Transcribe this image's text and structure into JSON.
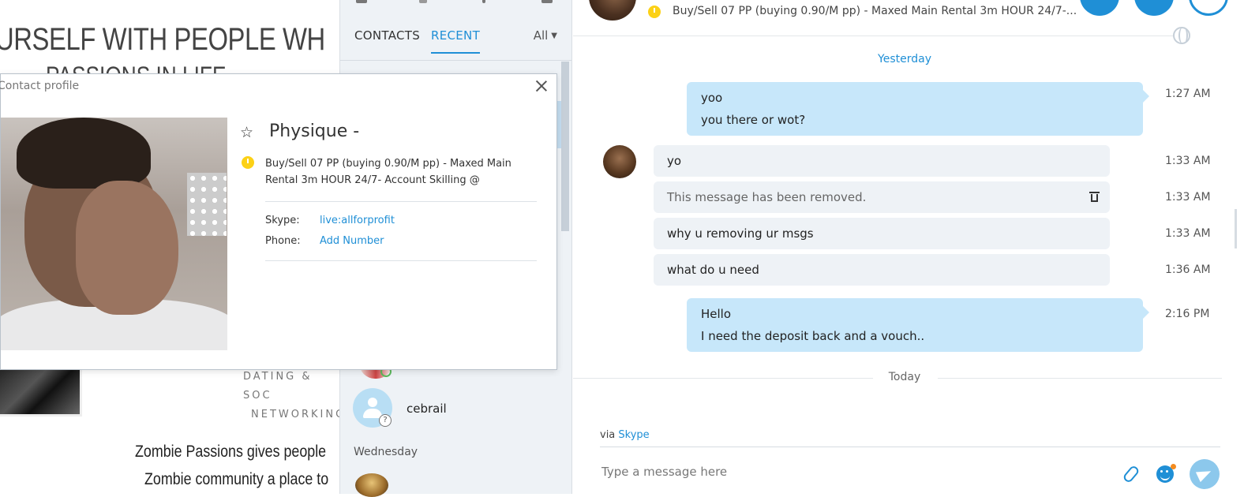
{
  "background_page": {
    "headline_line1": "URSELF WITH PEOPLE WH",
    "headline_line2": "PASSIONS IN LIFE",
    "dating_line1": "DATING & SOC",
    "dating_line2": "NETWORKING",
    "para_line1": "Zombie Passions gives people",
    "para_line2": "Zombie community a place to"
  },
  "contacts_panel": {
    "tabs": [
      "CONTACTS",
      "RECENT"
    ],
    "active_tab": "RECENT",
    "filter_label": "All",
    "contact_name": "cebrail",
    "day_label": "Wednesday"
  },
  "chat": {
    "status_text": "Buy/Sell 07 PP (buying 0.90/M pp) - Maxed Main Rental 3m HOUR 24/7-...",
    "date_yesterday": "Yesterday",
    "date_today": "Today",
    "messages": [
      {
        "direction": "out",
        "lines": [
          "yoo",
          "you there or wot?"
        ],
        "time": "1:27 AM"
      },
      {
        "direction": "in",
        "text": "yo",
        "time": "1:33 AM"
      },
      {
        "direction": "in",
        "text": "This message has been removed.",
        "time": "1:33 AM",
        "removed": true
      },
      {
        "direction": "in",
        "text": "why u removing ur msgs",
        "time": "1:33 AM"
      },
      {
        "direction": "in",
        "text": "what do u need",
        "time": "1:36 AM"
      },
      {
        "direction": "out",
        "lines": [
          "Hello",
          "I need the deposit back and a vouch.."
        ],
        "time": "2:16 PM"
      }
    ],
    "via_prefix": "via",
    "via_link": "Skype",
    "compose_placeholder": "Type a message here"
  },
  "profile": {
    "title": "Contact profile",
    "name": "Physique -",
    "status": "Buy/Sell 07 PP (buying 0.90/M pp) - Maxed Main Rental 3m HOUR 24/7- Account Skilling @",
    "skype_label": "Skype:",
    "skype_value": "live:allforprofit",
    "phone_label": "Phone:",
    "phone_value": "Add Number"
  },
  "colors": {
    "accent": "#1f8fd6",
    "outgoing_bubble": "#c7e7fa",
    "incoming_bubble": "#eef2f6",
    "away_status": "#fcd116"
  },
  "icons": [
    "star-icon",
    "close-icon",
    "away-status-icon",
    "trash-icon",
    "globe-icon",
    "attach-icon",
    "emoji-icon",
    "send-icon",
    "chevron-down-icon",
    "video-call-icon",
    "audio-call-icon",
    "add-person-icon"
  ]
}
